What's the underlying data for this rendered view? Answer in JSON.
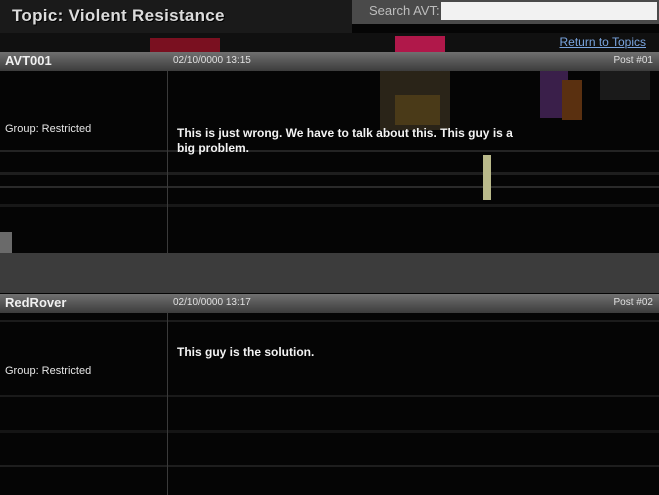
{
  "topic": {
    "title": "Topic:  Violent Resistance"
  },
  "search": {
    "label": "Search AVT:",
    "value": ""
  },
  "nav": {
    "return_label": "Return to Topics"
  },
  "posts": [
    {
      "author": "AVT001",
      "date": "02/10/0000 13:15",
      "number": "Post #01",
      "group": "Group:  Restricted",
      "body": "This is just wrong. We have to talk about this. This guy is a big problem."
    },
    {
      "author": "RedRover",
      "date": "02/10/0000 13:17",
      "number": "Post #02",
      "group": "Group:  Restricted",
      "body": "This guy is the solution."
    }
  ],
  "colors": {
    "link": "#7aa5e0",
    "header_bar": "#585858",
    "background": "#050505"
  }
}
